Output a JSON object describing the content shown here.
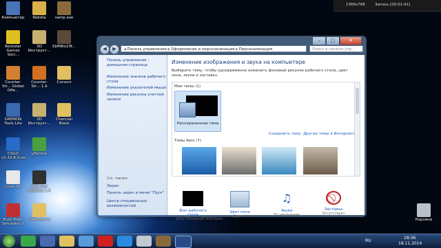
{
  "recorder": {
    "resolution": "1366x768",
    "status": "Запись [00:01:42]"
  },
  "desktop_icons": [
    {
      "label": "Компьютер",
      "color": "#4a74b8"
    },
    {
      "label": "Robota",
      "color": "#d9b14a"
    },
    {
      "label": "samp.exe",
      "color": "#8a6a3a"
    },
    {
      "label": "Rockstar Games Soci...",
      "color": "#e0c020"
    },
    {
      "label": "3D Инструкт...",
      "color": "#c8b070"
    },
    {
      "label": "SbfN6o1f8...",
      "color": "#5a4a3a"
    },
    {
      "label": "Counter-Str... Global Offe...",
      "color": "#d08030"
    },
    {
      "label": "Counter-Str... 1.6",
      "color": "#d07020"
    },
    {
      "label": "Cursors",
      "color": "#e0c060"
    },
    {
      "label": "DAEMON Tools Lite",
      "color": "#3a6ab0"
    },
    {
      "label": "3D Инструкт...",
      "color": "#c8b070"
    },
    {
      "label": "Charcoal Black",
      "color": "#e0c060"
    },
    {
      "label": "CSGO v1.32.8.0.iso",
      "color": "#2a6ac8"
    },
    {
      "label": "µTorrent",
      "color": "#4aa040"
    },
    {
      "label": "Ссыл.txt",
      "color": "#e8e8e8"
    },
    {
      "label": "MTA San Andreas 1.4",
      "color": "#303030"
    },
    {
      "label": "Euro Truck Simulator 2",
      "color": "#c03030"
    },
    {
      "label": "Смкл фото",
      "color": "#e0c060"
    },
    {
      "label": "Корзина",
      "color": "#b8c0c8"
    }
  ],
  "window": {
    "breadcrumb": "◂ Панель управления ▸ Оформление и персонализация ▸ Персонализация",
    "search_placeholder": "Поиск в панели упр...",
    "left_links": [
      "Панель управления - домашняя страница",
      "Изменение значков рабочего стола",
      "Изменение указателей мыши",
      "Изменение рисунка учетной записи"
    ],
    "see_also": "См. также",
    "see_also_links": [
      "Экран",
      "Панель задач и меню \"Пуск\"",
      "Центр специальных возможностей"
    ],
    "heading": "Изменение изображения и звука на компьютере",
    "description": "Выберите тему, чтобы одновременно изменить фоновый рисунок рабочего стола, цвет окна, звуки и заставку.",
    "my_themes": "Мои темы (1)",
    "unsaved_theme": "Несохраненная тема",
    "save_theme": "Сохранить тему",
    "more_themes": "Другие темы в Интернете",
    "aero_themes": "Темы Aero (7)",
    "bottom": [
      {
        "title": "Фон рабочего стола",
        "sub": "905a7900dbad8799f16ebd..."
      },
      {
        "title": "Цвет окна",
        "sub": "Другой"
      },
      {
        "title": "Звуки",
        "sub": "По умолчанию"
      },
      {
        "title": "Заставка",
        "sub": "Отсутствует"
      }
    ]
  },
  "taskbar": {
    "lang": "RU",
    "time": "18:36",
    "date": "18.11.2014"
  }
}
